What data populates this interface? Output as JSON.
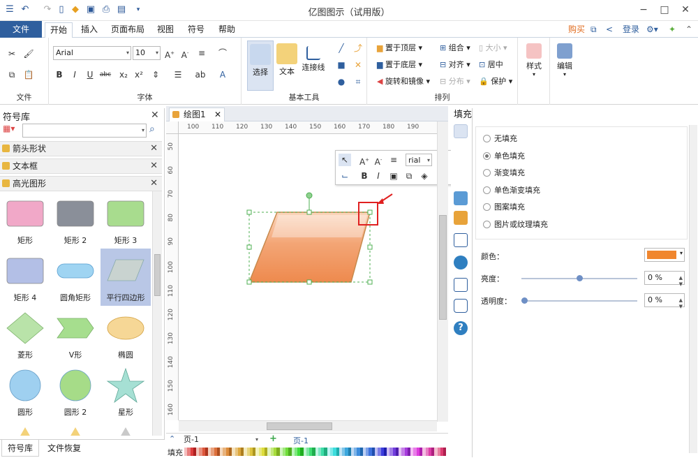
{
  "window": {
    "title": "亿图图示（试用版）",
    "minimize": "−",
    "maximize": "□",
    "close": "✕"
  },
  "menu": {
    "file": "文件",
    "tabs": [
      "开始",
      "插入",
      "页面布局",
      "视图",
      "符号",
      "帮助"
    ],
    "buy": "购买",
    "login": "登录"
  },
  "ribbon": {
    "font_name": "Arial",
    "font_size": "10",
    "groups": {
      "file": "文件",
      "font": "字体",
      "basic_tools": "基本工具",
      "arrange": "排列",
      "style": "样式",
      "edit": "编辑"
    },
    "tools": {
      "select": "选择",
      "text": "文本",
      "connector": "连接线"
    },
    "arrange": {
      "bring_front": "置于顶层",
      "send_back": "置于底层",
      "rotate_mirror": "旋转和镜像",
      "group": "组合",
      "align": "对齐",
      "distribute": "分布",
      "size": "大小",
      "center": "居中",
      "protect": "保护"
    },
    "style": "样式",
    "edit": "编辑"
  },
  "symbol_panel": {
    "title": "符号库",
    "categories": [
      "箭头形状",
      "文本框",
      "高光图形"
    ],
    "shapes": [
      {
        "label": "矩形",
        "color": "#f1a8c8"
      },
      {
        "label": "矩形 2",
        "color": "#8a8f99"
      },
      {
        "label": "矩形 3",
        "color": "#a8dc8e"
      },
      {
        "label": "矩形 4",
        "color": "#b3bfe6"
      },
      {
        "label": "圆角矩形",
        "color": "#9fd4f2"
      },
      {
        "label": "平行四边形",
        "color": "#c9d3d0"
      },
      {
        "label": "菱形",
        "color": "#b9e3a9"
      },
      {
        "label": "V形",
        "color": "#a6de8e"
      },
      {
        "label": "椭圆",
        "color": "#f6d796"
      },
      {
        "label": "圆形",
        "color": "#9fd0f0"
      },
      {
        "label": "圆形 2",
        "color": "#a6dc88"
      },
      {
        "label": "星形",
        "color": "#a6e0d4"
      }
    ],
    "bottom_tabs": [
      "符号库",
      "文件恢复"
    ]
  },
  "document": {
    "tab_title": "绘图1",
    "ruler_h": [
      "100",
      "110",
      "120",
      "130",
      "140",
      "150",
      "160",
      "170",
      "180",
      "190"
    ],
    "ruler_v": [
      "50",
      "60",
      "70",
      "80",
      "90",
      "100",
      "110",
      "120",
      "130",
      "140",
      "150",
      "160"
    ],
    "page_select": "页-1",
    "page_tab": "页-1",
    "color_label": "填充",
    "shape_fill": "#f0915a"
  },
  "mini_toolbar": {
    "font": "rial"
  },
  "fill_panel": {
    "title": "填充",
    "options": [
      "无填充",
      "单色填充",
      "渐变填充",
      "单色渐变填充",
      "图案填充",
      "图片或纹理填充"
    ],
    "selected": 1,
    "color_label": "颜色：",
    "color_value": "#f0862e",
    "brightness_label": "亮度：",
    "brightness_value": "0 %",
    "brightness_level": 0.5,
    "transparency_label": "透明度：",
    "transparency_value": "0 %",
    "transparency_level": 0.0
  }
}
